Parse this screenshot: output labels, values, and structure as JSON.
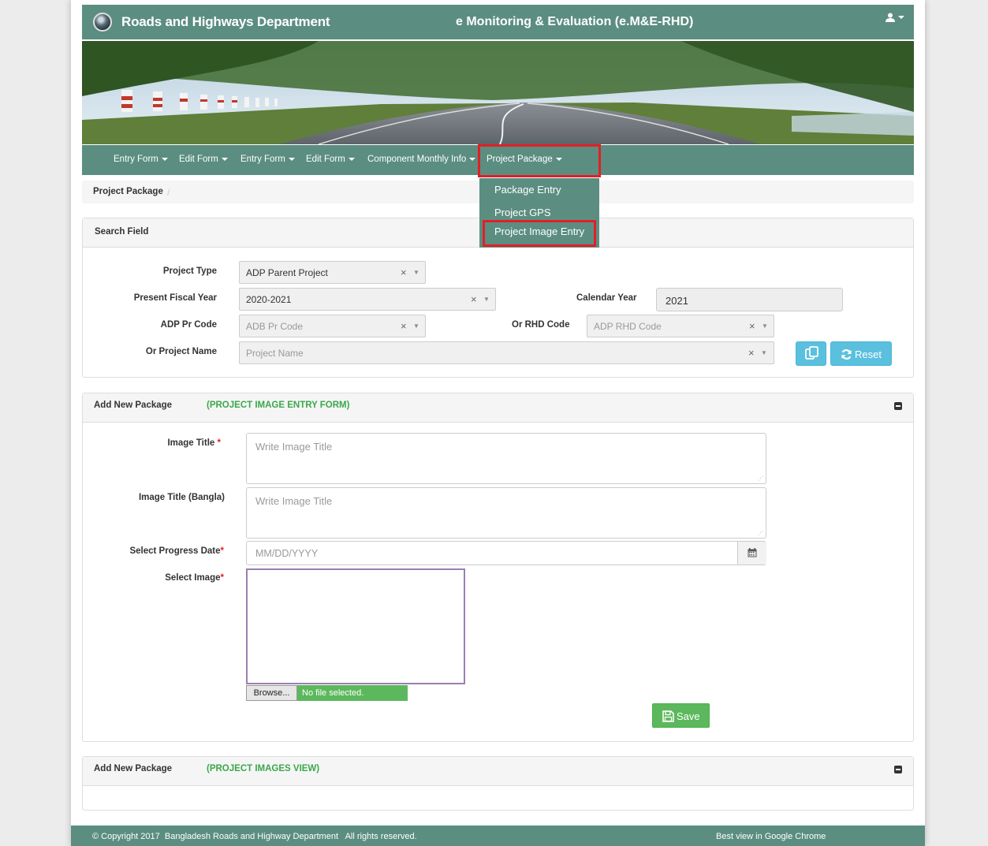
{
  "header": {
    "brand": "Roads and Highways Department",
    "center_title": "e Monitoring & Evaluation (e.M&E-RHD)"
  },
  "nav": {
    "items": [
      "Entry Form",
      "Edit Form",
      "Entry Form",
      "Edit Form",
      "Component Monthly Info",
      "Project Package"
    ]
  },
  "dropdown": {
    "items": [
      "Package Entry",
      "Project GPS",
      "Project Image Entry"
    ]
  },
  "breadcrumb": {
    "current": "Project Package",
    "separator": "/"
  },
  "search": {
    "title": "Search Field",
    "project_type_label": "Project Type",
    "project_type_value": "ADP Parent Project",
    "fiscal_year_label": "Present Fiscal Year",
    "fiscal_year_value": "2020-2021",
    "calendar_year_label": "Calendar Year",
    "calendar_year_value": "2021",
    "adp_code_label": "ADP Pr Code",
    "adp_code_placeholder": "ADB Pr Code",
    "rhd_code_label": "Or RHD Code",
    "rhd_code_placeholder": "ADP RHD Code",
    "project_name_label": "Or Project Name",
    "project_name_placeholder": "Project Name",
    "clear_symbol": "×",
    "arrow_symbol": "▼",
    "reset_label": "Reset"
  },
  "form": {
    "title": "Add New Package",
    "subtitle": "(PROJECT IMAGE ENTRY FORM)",
    "image_title_label": "Image Title",
    "image_title_placeholder": "Write Image Title",
    "image_title_bangla_label": "Image Title (Bangla)",
    "image_title_bangla_placeholder": "Write Image Title",
    "progress_date_label": "Select Progress Date",
    "progress_date_placeholder": "MM/DD/YYYY",
    "select_image_label": "Select Image",
    "required_mark": "*",
    "browse_label": "Browse...",
    "file_status": "No file selected.",
    "save_label": "Save"
  },
  "view": {
    "title": "Add New Package",
    "subtitle": "(PROJECT IMAGES VIEW)"
  },
  "footer": {
    "copyright": "© Copyright 2017  Bangladesh Roads and Highway Department   All rights reserved.",
    "best_view": "Best view in Google Chrome"
  },
  "colors": {
    "header_bg": "#5b8e80",
    "highlight": "#e21f26",
    "info_button": "#5bc0de",
    "success_button": "#5cb85c",
    "subtitle_green": "#3aa84a"
  }
}
